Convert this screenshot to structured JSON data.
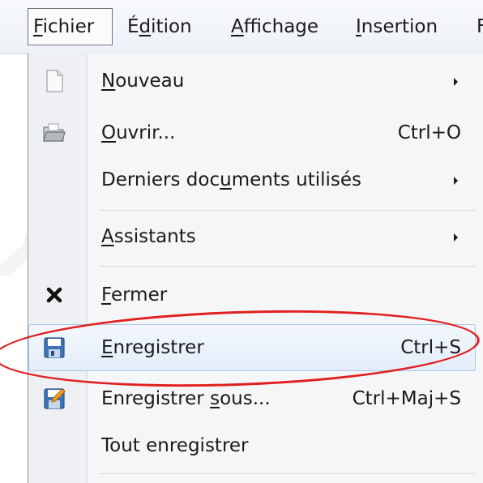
{
  "menubar": {
    "items": [
      {
        "label": "Fichier",
        "accel": "F",
        "rest": "ichier"
      },
      {
        "label": "Édition",
        "pre": "É",
        "accel": "d",
        "rest": "ition"
      },
      {
        "label": "Affichage",
        "accel": "A",
        "rest": "ffichage"
      },
      {
        "label": "Insertion",
        "accel": "I",
        "rest": "nsertion"
      },
      {
        "label": "F"
      }
    ]
  },
  "menu": {
    "items": [
      {
        "accel": "N",
        "rest": "ouveau",
        "has_submenu": true,
        "icon": "new-document-icon"
      },
      {
        "accel": "O",
        "rest": "uvrir...",
        "shortcut": "Ctrl+O",
        "icon": "open-folder-icon"
      },
      {
        "pre": "Derniers doc",
        "accel": "u",
        "rest": "ments utilisés",
        "has_submenu": true
      },
      {
        "accel": "A",
        "rest": "ssistants",
        "has_submenu": true
      },
      {
        "accel": "F",
        "rest": "ermer",
        "icon": "close-icon"
      },
      {
        "accel": "E",
        "rest": "nregistrer",
        "shortcut": "Ctrl+S",
        "icon": "save-icon",
        "highlighted": true
      },
      {
        "pre": "Enregistrer ",
        "accel": "s",
        "rest": "ous...",
        "shortcut": "Ctrl+Maj+S",
        "icon": "save-as-icon"
      },
      {
        "label": "Tout enregistrer"
      }
    ]
  },
  "colors": {
    "highlight_ellipse": "#e02020",
    "hover_border": "#a9c8ec"
  }
}
